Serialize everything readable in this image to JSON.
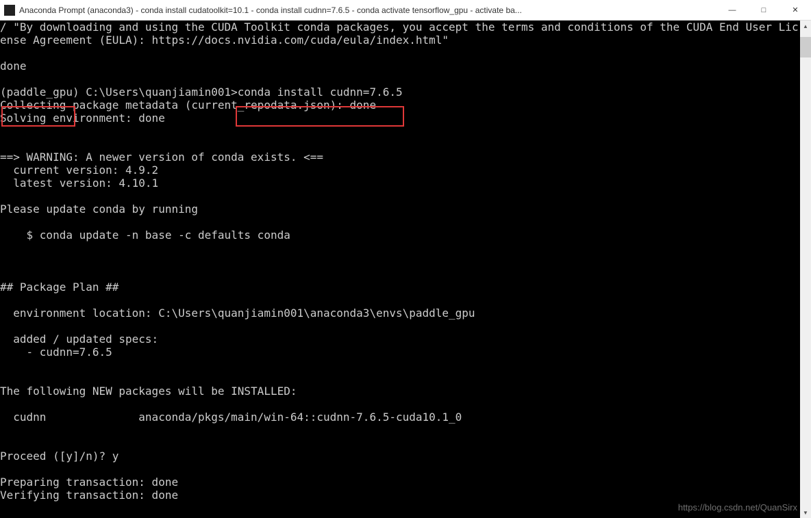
{
  "titlebar": {
    "title": "Anaconda Prompt (anaconda3) - conda  install cudatoolkit=10.1 - conda  install cudnn=7.6.5 - conda  activate tensorflow_gpu - activate  ba...",
    "minimize": "—",
    "maximize": "□",
    "close": "✕"
  },
  "terminal": {
    "line1": "/ \"By downloading and using the CUDA Toolkit conda packages, you accept the terms and conditions of the CUDA End User Lic",
    "line2": "ense Agreement (EULA): https://docs.nvidia.com/cuda/eula/index.html\"",
    "line3": "",
    "line4": "done",
    "line5": "",
    "prompt_env": "(paddle_gpu)",
    "prompt_path": " C:\\Users\\quanjiamin001>",
    "prompt_cmd": "conda install cudnn=7.6.5",
    "line7": "Collecting package metadata (current_repodata.json): done",
    "line8": "Solving environment: done",
    "line9": "",
    "line10": "",
    "line11": "==> WARNING: A newer version of conda exists. <==",
    "line12": "  current version: 4.9.2",
    "line13": "  latest version: 4.10.1",
    "line14": "",
    "line15": "Please update conda by running",
    "line16": "",
    "line17": "    $ conda update -n base -c defaults conda",
    "line18": "",
    "line19": "",
    "line20": "",
    "line21": "## Package Plan ##",
    "line22": "",
    "line23": "  environment location: C:\\Users\\quanjiamin001\\anaconda3\\envs\\paddle_gpu",
    "line24": "",
    "line25": "  added / updated specs:",
    "line26": "    - cudnn=7.6.5",
    "line27": "",
    "line28": "",
    "line29": "The following NEW packages will be INSTALLED:",
    "line30": "",
    "line31": "  cudnn              anaconda/pkgs/main/win-64::cudnn-7.6.5-cuda10.1_0",
    "line32": "",
    "line33": "",
    "line34": "Proceed ([y]/n)? y",
    "line35": "",
    "line36": "Preparing transaction: done",
    "line37": "Verifying transaction: done"
  },
  "watermark": "https://blog.csdn.net/QuanSirx",
  "scrollbar": {
    "up": "▲",
    "down": "▼"
  }
}
